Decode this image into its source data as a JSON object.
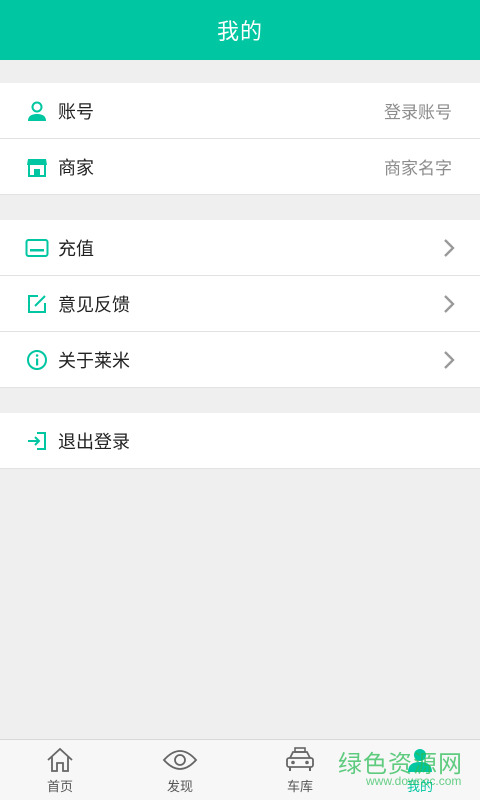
{
  "header": {
    "title": "我的"
  },
  "account_group": {
    "items": [
      {
        "label": "账号",
        "value": "登录账号",
        "icon": "user-icon"
      },
      {
        "label": "商家",
        "value": "商家名字",
        "icon": "shop-icon"
      }
    ]
  },
  "menu_group": {
    "items": [
      {
        "label": "充值",
        "icon": "card-icon"
      },
      {
        "label": "意见反馈",
        "icon": "edit-icon"
      },
      {
        "label": "关于莱米",
        "icon": "info-icon"
      }
    ]
  },
  "logout": {
    "label": "退出登录",
    "icon": "logout-icon"
  },
  "tabbar": {
    "tabs": [
      {
        "label": "首页",
        "icon": "home-icon",
        "active": false
      },
      {
        "label": "发现",
        "icon": "eye-icon",
        "active": false
      },
      {
        "label": "车库",
        "icon": "car-icon",
        "active": false
      },
      {
        "label": "我的",
        "icon": "person-icon",
        "active": true
      }
    ]
  },
  "watermark": {
    "main": "绿色资源网",
    "sub": "www.downcc.com"
  },
  "colors": {
    "accent": "#00c6a1",
    "background": "#efefef",
    "watermark": "#2bbd57"
  }
}
